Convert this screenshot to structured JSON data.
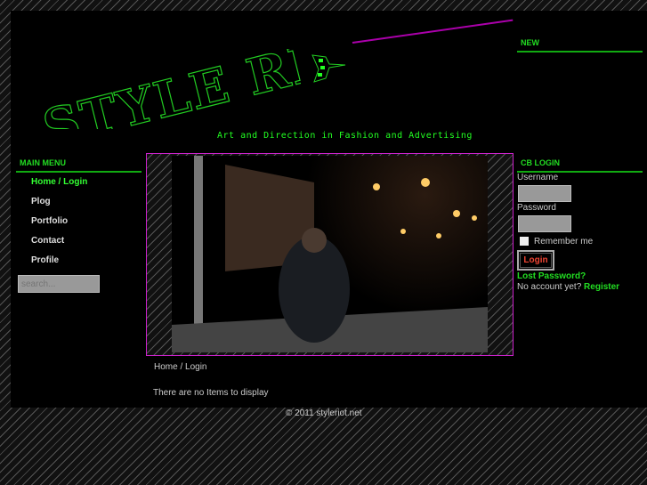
{
  "header": {
    "logo_text": "STYLE RIOT",
    "tagline": "Art and Direction in Fashion and Advertising",
    "new_label": "NEW"
  },
  "sidebar": {
    "title": "MAIN MENU",
    "items": [
      {
        "label": "Home / Login"
      },
      {
        "label": "Plog"
      },
      {
        "label": "Portfolio"
      },
      {
        "label": "Contact"
      },
      {
        "label": "Profile"
      }
    ],
    "search_placeholder": "search..."
  },
  "main": {
    "breadcrumb": "Home / Login",
    "empty_message": "There are no Items to display"
  },
  "login": {
    "title": "CB LOGIN",
    "username_label": "Username",
    "password_label": "Password",
    "remember_label": "Remember me",
    "login_button": "Login",
    "lost_password": "Lost Password?",
    "no_account": "No account yet?",
    "register": "Register"
  },
  "footer": {
    "copyright": "© 2011 styleriot.net"
  },
  "colors": {
    "accent": "#22dd22",
    "border": "#cc22cc",
    "button_text": "#ee4433"
  }
}
